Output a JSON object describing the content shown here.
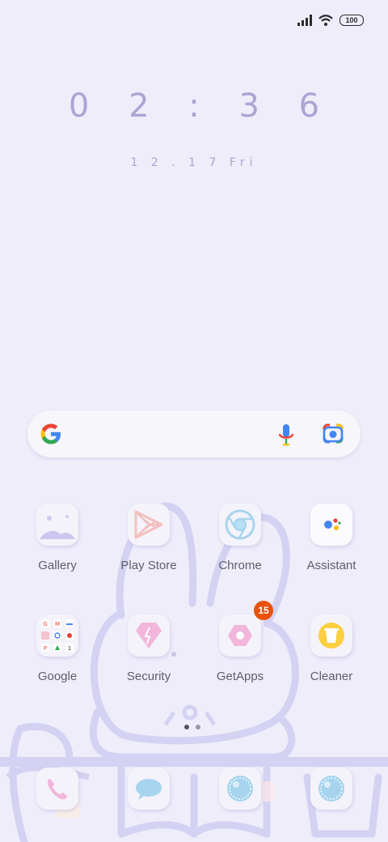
{
  "status_bar": {
    "battery": "100"
  },
  "lock": {
    "time": "0 2 : 3 6",
    "date": "1 2 . 1 7   Fri"
  },
  "search": {
    "mic_icon": "mic-icon",
    "lens_icon": "google-lens-icon"
  },
  "apps": [
    {
      "label": "Gallery",
      "icon": "gallery-icon"
    },
    {
      "label": "Play Store",
      "icon": "play-store-icon"
    },
    {
      "label": "Chrome",
      "icon": "chrome-icon"
    },
    {
      "label": "Assistant",
      "icon": "assistant-icon"
    },
    {
      "label": "Google",
      "icon": "google-folder-icon"
    },
    {
      "label": "Security",
      "icon": "security-icon"
    },
    {
      "label": "GetApps",
      "icon": "getapps-icon",
      "badge": "15"
    },
    {
      "label": "Cleaner",
      "icon": "cleaner-icon"
    }
  ],
  "dock": [
    {
      "icon": "phone-icon"
    },
    {
      "icon": "messages-icon"
    },
    {
      "icon": "browser-icon"
    },
    {
      "icon": "camera-icon"
    }
  ],
  "page_indicator": {
    "pages": 2,
    "current": 1
  },
  "colors": {
    "background": "#efedfa",
    "clock": "#a9a5d4",
    "badge": "#e8520c"
  }
}
